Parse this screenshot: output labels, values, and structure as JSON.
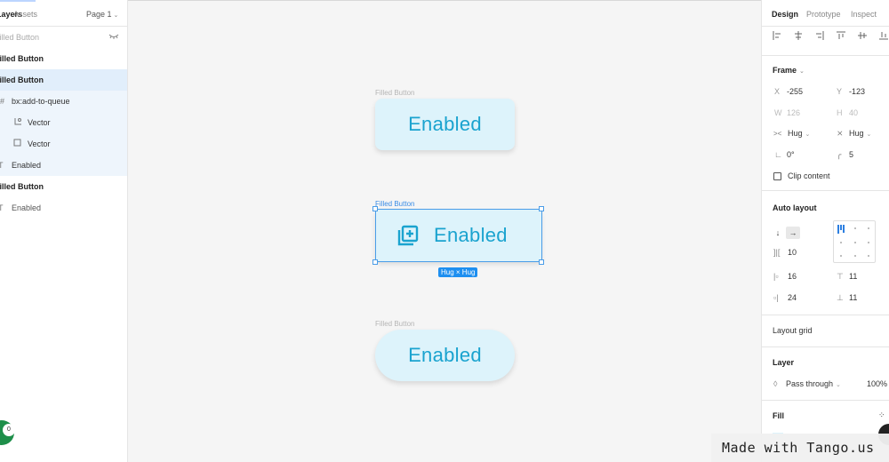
{
  "left_panel": {
    "tabs": {
      "layers": "Layers",
      "assets": "Assets"
    },
    "page": {
      "label": "Page 1",
      "chevron_icon": "chevron-down-icon"
    },
    "layers": [
      {
        "label": "Filled Button",
        "style": "faded",
        "icon": "frame-icon"
      },
      {
        "label": "Filled Button",
        "style": "bold",
        "icon": "frame-icon"
      },
      {
        "label": "Filled Button",
        "style": "bold-selected",
        "icon": "frame-icon"
      },
      {
        "label": "bx:add-to-queue",
        "style": "child",
        "icon": "frame-icon"
      },
      {
        "label": "Vector",
        "style": "child",
        "icon": "vector-icon"
      },
      {
        "label": "Vector",
        "style": "child",
        "icon": "square-icon"
      },
      {
        "label": "Enabled",
        "style": "child",
        "icon": "text-icon"
      },
      {
        "label": "Filled Button",
        "style": "bold",
        "icon": "frame-icon"
      },
      {
        "label": "Enabled",
        "style": "normal",
        "icon": "text-icon"
      }
    ],
    "comment_count": "0"
  },
  "canvas": {
    "frames": [
      {
        "label": "Filled Button",
        "button_text": "Enabled",
        "shape": "rounded-small"
      },
      {
        "label": "Filled Button",
        "button_text": "Enabled",
        "shape": "rounded-small-icon",
        "selected": true
      },
      {
        "label": "Filled Button",
        "button_text": "Enabled",
        "shape": "pill"
      }
    ],
    "size_badge": "Hug × Hug",
    "colors": {
      "button_bg": "#ddf3fb",
      "button_text": "#1aa3cf",
      "selection": "#4a9de8"
    }
  },
  "right_panel": {
    "tabs": [
      "Design",
      "Prototype",
      "Inspect"
    ],
    "frame": {
      "title": "Frame",
      "x_label": "X",
      "x": "-255",
      "y_label": "Y",
      "y": "-123",
      "w_label": "W",
      "w": "126",
      "h_label": "H",
      "h": "40",
      "width_mode": "Hug",
      "height_mode": "Hug",
      "rotation": "0°",
      "radius": "5",
      "clip_content": "Clip content"
    },
    "auto_layout": {
      "title": "Auto layout",
      "spacing": "10",
      "padding_left": "16",
      "padding_top": "11",
      "padding_right": "24",
      "padding_bottom": "11"
    },
    "layout_grid": {
      "title": "Layout grid"
    },
    "layer": {
      "title": "Layer",
      "blend_mode": "Pass through",
      "opacity": "100%"
    },
    "fill": {
      "title": "Fill"
    }
  },
  "watermark": "Made with Tango.us"
}
